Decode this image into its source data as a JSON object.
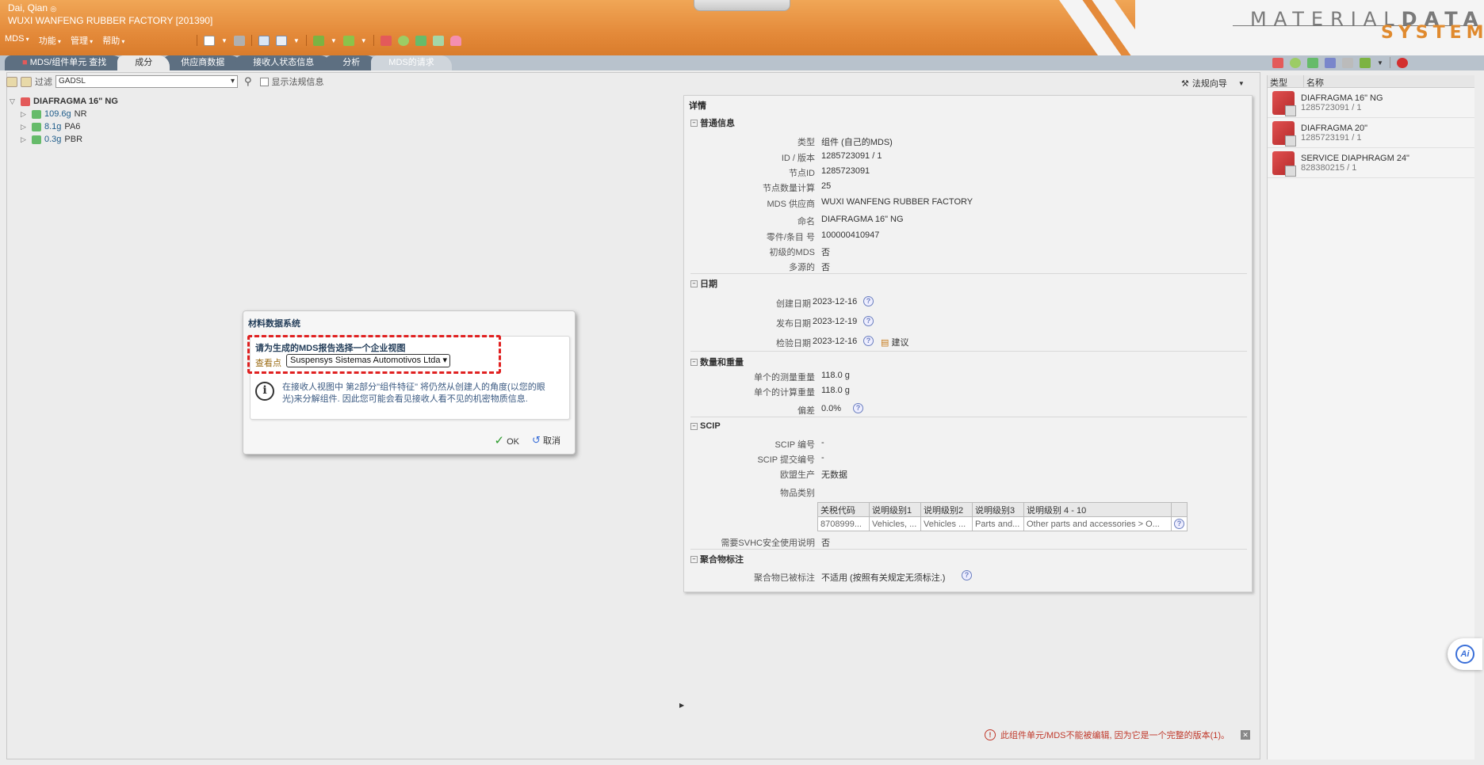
{
  "header": {
    "user": "Dai, Qian",
    "company": "WUXI WANFENG RUBBER FACTORY [201390]",
    "logo_line1": "MATERIAL",
    "logo_line1_bold": "DATA",
    "logo_line2": "SYSTEM"
  },
  "menu": [
    "MDS",
    "功能",
    "管理",
    "帮助"
  ],
  "tabs": [
    "MDS/组件单元 查找",
    "成分",
    "供应商数据",
    "接收人状态信息",
    "分析",
    "MDS的请求"
  ],
  "filter": {
    "label": "过滤",
    "value": "GADSL",
    "checkbox_label": "显示法规信息"
  },
  "regulation_wizard": "法规向导",
  "tree": {
    "root": "DIAFRAGMA 16\" NG",
    "children": [
      {
        "weight": "109.6g",
        "name": "NR"
      },
      {
        "weight": "8.1g",
        "name": "PA6"
      },
      {
        "weight": "0.3g",
        "name": "PBR"
      }
    ]
  },
  "detail": {
    "title": "详情",
    "general": {
      "title": "普通信息",
      "rows": [
        {
          "k": "类型",
          "v": "组件 (自己的MDS)"
        },
        {
          "k": "ID / 版本",
          "v": "1285723091 / 1"
        },
        {
          "k": "节点ID",
          "v": "1285723091"
        },
        {
          "k": "节点数量计算",
          "v": "25"
        },
        {
          "k": "MDS 供应商",
          "v": "WUXI WANFENG RUBBER FACTORY"
        },
        {
          "k": "命名",
          "v": "DIAFRAGMA 16\" NG"
        },
        {
          "k": "零件/条目 号",
          "v": "100000410947"
        },
        {
          "k": "初级的MDS",
          "v": "否"
        },
        {
          "k": "多源的",
          "v": "否"
        }
      ]
    },
    "dates": {
      "title": "日期",
      "rows": [
        {
          "k": "创建日期",
          "v": "2023-12-16"
        },
        {
          "k": "发布日期",
          "v": "2023-12-19"
        },
        {
          "k": "检验日期",
          "v": "2023-12-16"
        }
      ],
      "suggest": "建议"
    },
    "weight": {
      "title": "数量和重量",
      "rows": [
        {
          "k": "单个的测量重量",
          "v": "118.0  g"
        },
        {
          "k": "单个的计算重量",
          "v": "118.0  g"
        },
        {
          "k": "偏差",
          "v": "0.0%"
        }
      ]
    },
    "scip": {
      "title": "SCIP",
      "rows": [
        {
          "k": "SCIP 编号",
          "v": "-"
        },
        {
          "k": "SCIP 提交编号",
          "v": "-"
        },
        {
          "k": "欧盟生产",
          "v": "无数据"
        },
        {
          "k": "物品类别",
          "v": ""
        }
      ],
      "table_headers": [
        "关税代码",
        "说明级别1",
        "说明级别2",
        "说明级别3",
        "说明级别 4 - 10"
      ],
      "table_row": [
        "8708999...",
        "Vehicles, ...",
        "Vehicles ...",
        "Parts and...",
        "Other parts and accessories > O..."
      ],
      "svhc_label": "需要SVHC安全使用说明",
      "svhc_value": "否"
    },
    "polymer": {
      "title": "聚合物标注",
      "label": "聚合物已被标注",
      "value": "不适用 (按照有关规定无须标注.)"
    }
  },
  "right_panel": {
    "col_type": "类型",
    "col_name": "名称",
    "items": [
      {
        "name": "DIAFRAGMA 16\" NG",
        "id": "1285723091 / 1"
      },
      {
        "name": "DIAFRAGMA 20\"",
        "id": "1285723191 / 1"
      },
      {
        "name": "SERVICE DIAPHRAGM 24\"",
        "id": "828380215 / 1"
      }
    ]
  },
  "dialog": {
    "title": "材料数据系统",
    "heading": "请为生成的MDS报告选择一个企业视图",
    "view_label": "查看点",
    "view_value": "Suspensys Sistemas Automotivos Ltda",
    "info": "在接收人视图中 第2部分\"组件特征\" 将仍然从创建人的角度(以您的眼光)来分解组件. 因此您可能会看见接收人看不见的机密物质信息.",
    "ok": "OK",
    "cancel": "取消"
  },
  "ai_label": "Ai",
  "status": "此组件单元/MDS不能被编辑, 因为它是一个完整的版本(1)。"
}
